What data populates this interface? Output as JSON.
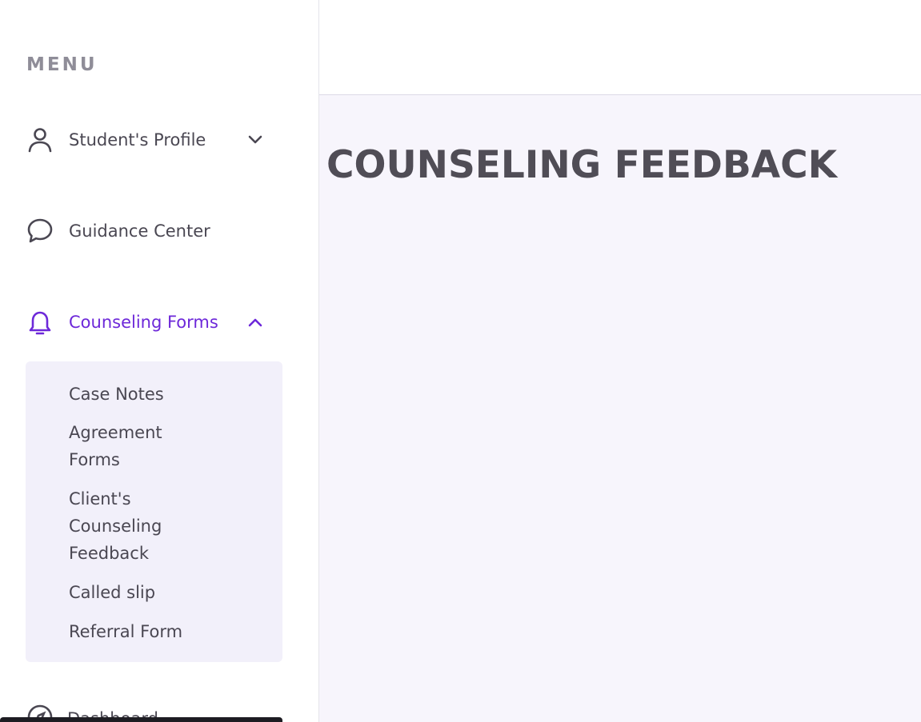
{
  "sidebar": {
    "menu_heading": "MENU",
    "items": [
      {
        "label": "Student's Profile",
        "icon": "user-icon",
        "expanded": false
      },
      {
        "label": "Guidance Center",
        "icon": "chat-bubble-icon",
        "expanded": false
      },
      {
        "label": "Counseling Forms",
        "icon": "bell-icon",
        "expanded": true,
        "active": true
      }
    ],
    "submenu": [
      {
        "label": "Case Notes"
      },
      {
        "label": "Agreement Forms"
      },
      {
        "label": "Client's Counseling Feedback"
      },
      {
        "label": "Called slip"
      },
      {
        "label": "Referral Form"
      }
    ],
    "dashboard": {
      "label": "Dashboard",
      "icon": "compass-icon"
    }
  },
  "main": {
    "title": "COUNSELING FEEDBACK"
  },
  "colors": {
    "accent": "#6d28d9",
    "text": "#4a4752",
    "main_bg": "#f7f5fc",
    "submenu_bg": "#f2f0fa"
  }
}
